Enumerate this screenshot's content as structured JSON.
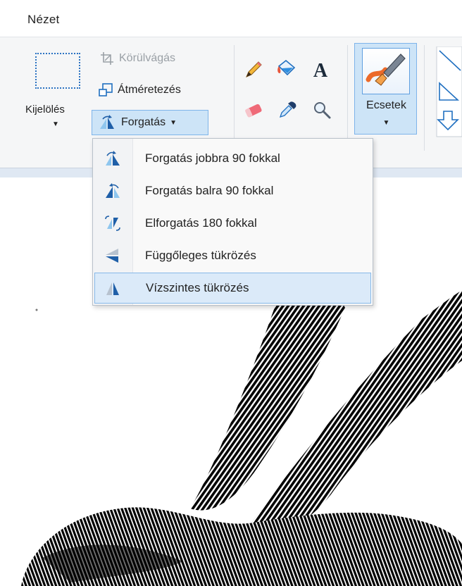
{
  "menu": {
    "tab": "Nézet"
  },
  "ribbon": {
    "select": {
      "label": "Kijelölés"
    },
    "image": {
      "crop": "Körülvágás",
      "resize": "Átméretezés",
      "rotate": "Forgatás"
    },
    "brushes": {
      "label": "Ecsetek"
    }
  },
  "dropdown": {
    "items": [
      {
        "label": "Forgatás jobbra 90 fokkal",
        "icon": "rotate-right-icon"
      },
      {
        "label": "Forgatás balra 90 fokkal",
        "icon": "rotate-left-icon"
      },
      {
        "label": "Elforgatás 180 fokkal",
        "icon": "rotate-180-icon"
      },
      {
        "label": "Függőleges tükrözés",
        "icon": "flip-vertical-icon"
      },
      {
        "label": "Vízszintes tükrözés",
        "icon": "flip-horizontal-icon"
      }
    ],
    "hovered_index": 4
  },
  "colors": {
    "accent": "#cde4f7",
    "accent_border": "#7eb4ea",
    "icon_blue": "#1f6fc0"
  }
}
